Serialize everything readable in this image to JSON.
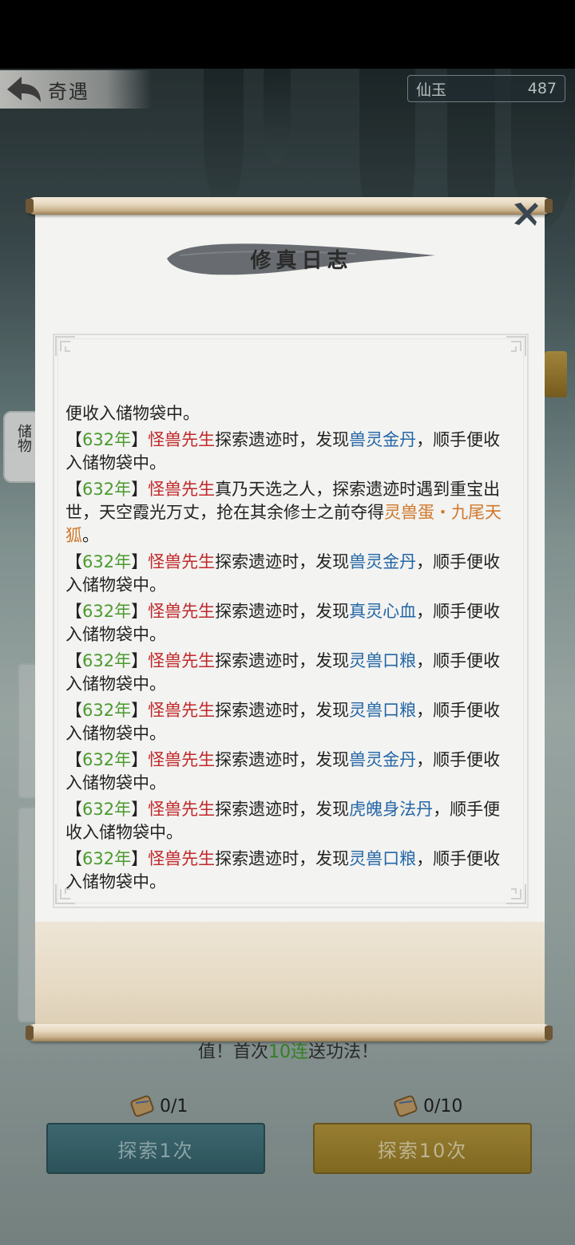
{
  "header": {
    "back_label": "奇遇",
    "currency_name": "仙玉",
    "currency_value": "487"
  },
  "popup": {
    "title": "修真日志",
    "first_line": "便收入储物袋中。",
    "entries": [
      {
        "year": "632年",
        "who": "怪兽先生",
        "pre": "探索遗迹时，发现",
        "item": "兽灵金丹",
        "post": "，顺手便收入储物袋中。"
      },
      {
        "year": "632年",
        "who": "怪兽先生",
        "pre": "真乃天选之人，探索遗迹时遇到重宝出世，天空霞光万丈，抢在其余修士之前夺得",
        "item": "灵兽蛋・九尾天狐",
        "post": "。",
        "rare": true
      },
      {
        "year": "632年",
        "who": "怪兽先生",
        "pre": "探索遗迹时，发现",
        "item": "兽灵金丹",
        "post": "，顺手便收入储物袋中。"
      },
      {
        "year": "632年",
        "who": "怪兽先生",
        "pre": "探索遗迹时，发现",
        "item": "真灵心血",
        "post": "，顺手便收入储物袋中。"
      },
      {
        "year": "632年",
        "who": "怪兽先生",
        "pre": "探索遗迹时，发现",
        "item": "灵兽口粮",
        "post": "，顺手便收入储物袋中。"
      },
      {
        "year": "632年",
        "who": "怪兽先生",
        "pre": "探索遗迹时，发现",
        "item": "灵兽口粮",
        "post": "，顺手便收入储物袋中。"
      },
      {
        "year": "632年",
        "who": "怪兽先生",
        "pre": "探索遗迹时，发现",
        "item": "兽灵金丹",
        "post": "，顺手便收入储物袋中。"
      },
      {
        "year": "632年",
        "who": "怪兽先生",
        "pre": "探索遗迹时，发现",
        "item": "虎魄身法丹",
        "post": "，顺手便收入储物袋中。"
      },
      {
        "year": "632年",
        "who": "怪兽先生",
        "pre": "探索遗迹时，发现",
        "item": "灵兽口粮",
        "post": "，顺手便收入储物袋中。"
      }
    ]
  },
  "background": {
    "side_tab_label": "储物",
    "promo_prefix": "值！首次",
    "promo_highlight": "10连",
    "promo_suffix": "送功法！"
  },
  "actions": {
    "cost_one": "0/1",
    "cost_ten": "0/10",
    "explore_one": "探索1次",
    "explore_ten": "探索10次"
  },
  "colors": {
    "year": "#4a9a2e",
    "name": "#c0282a",
    "item": "#2366a6",
    "rare_item": "#d0782a"
  }
}
